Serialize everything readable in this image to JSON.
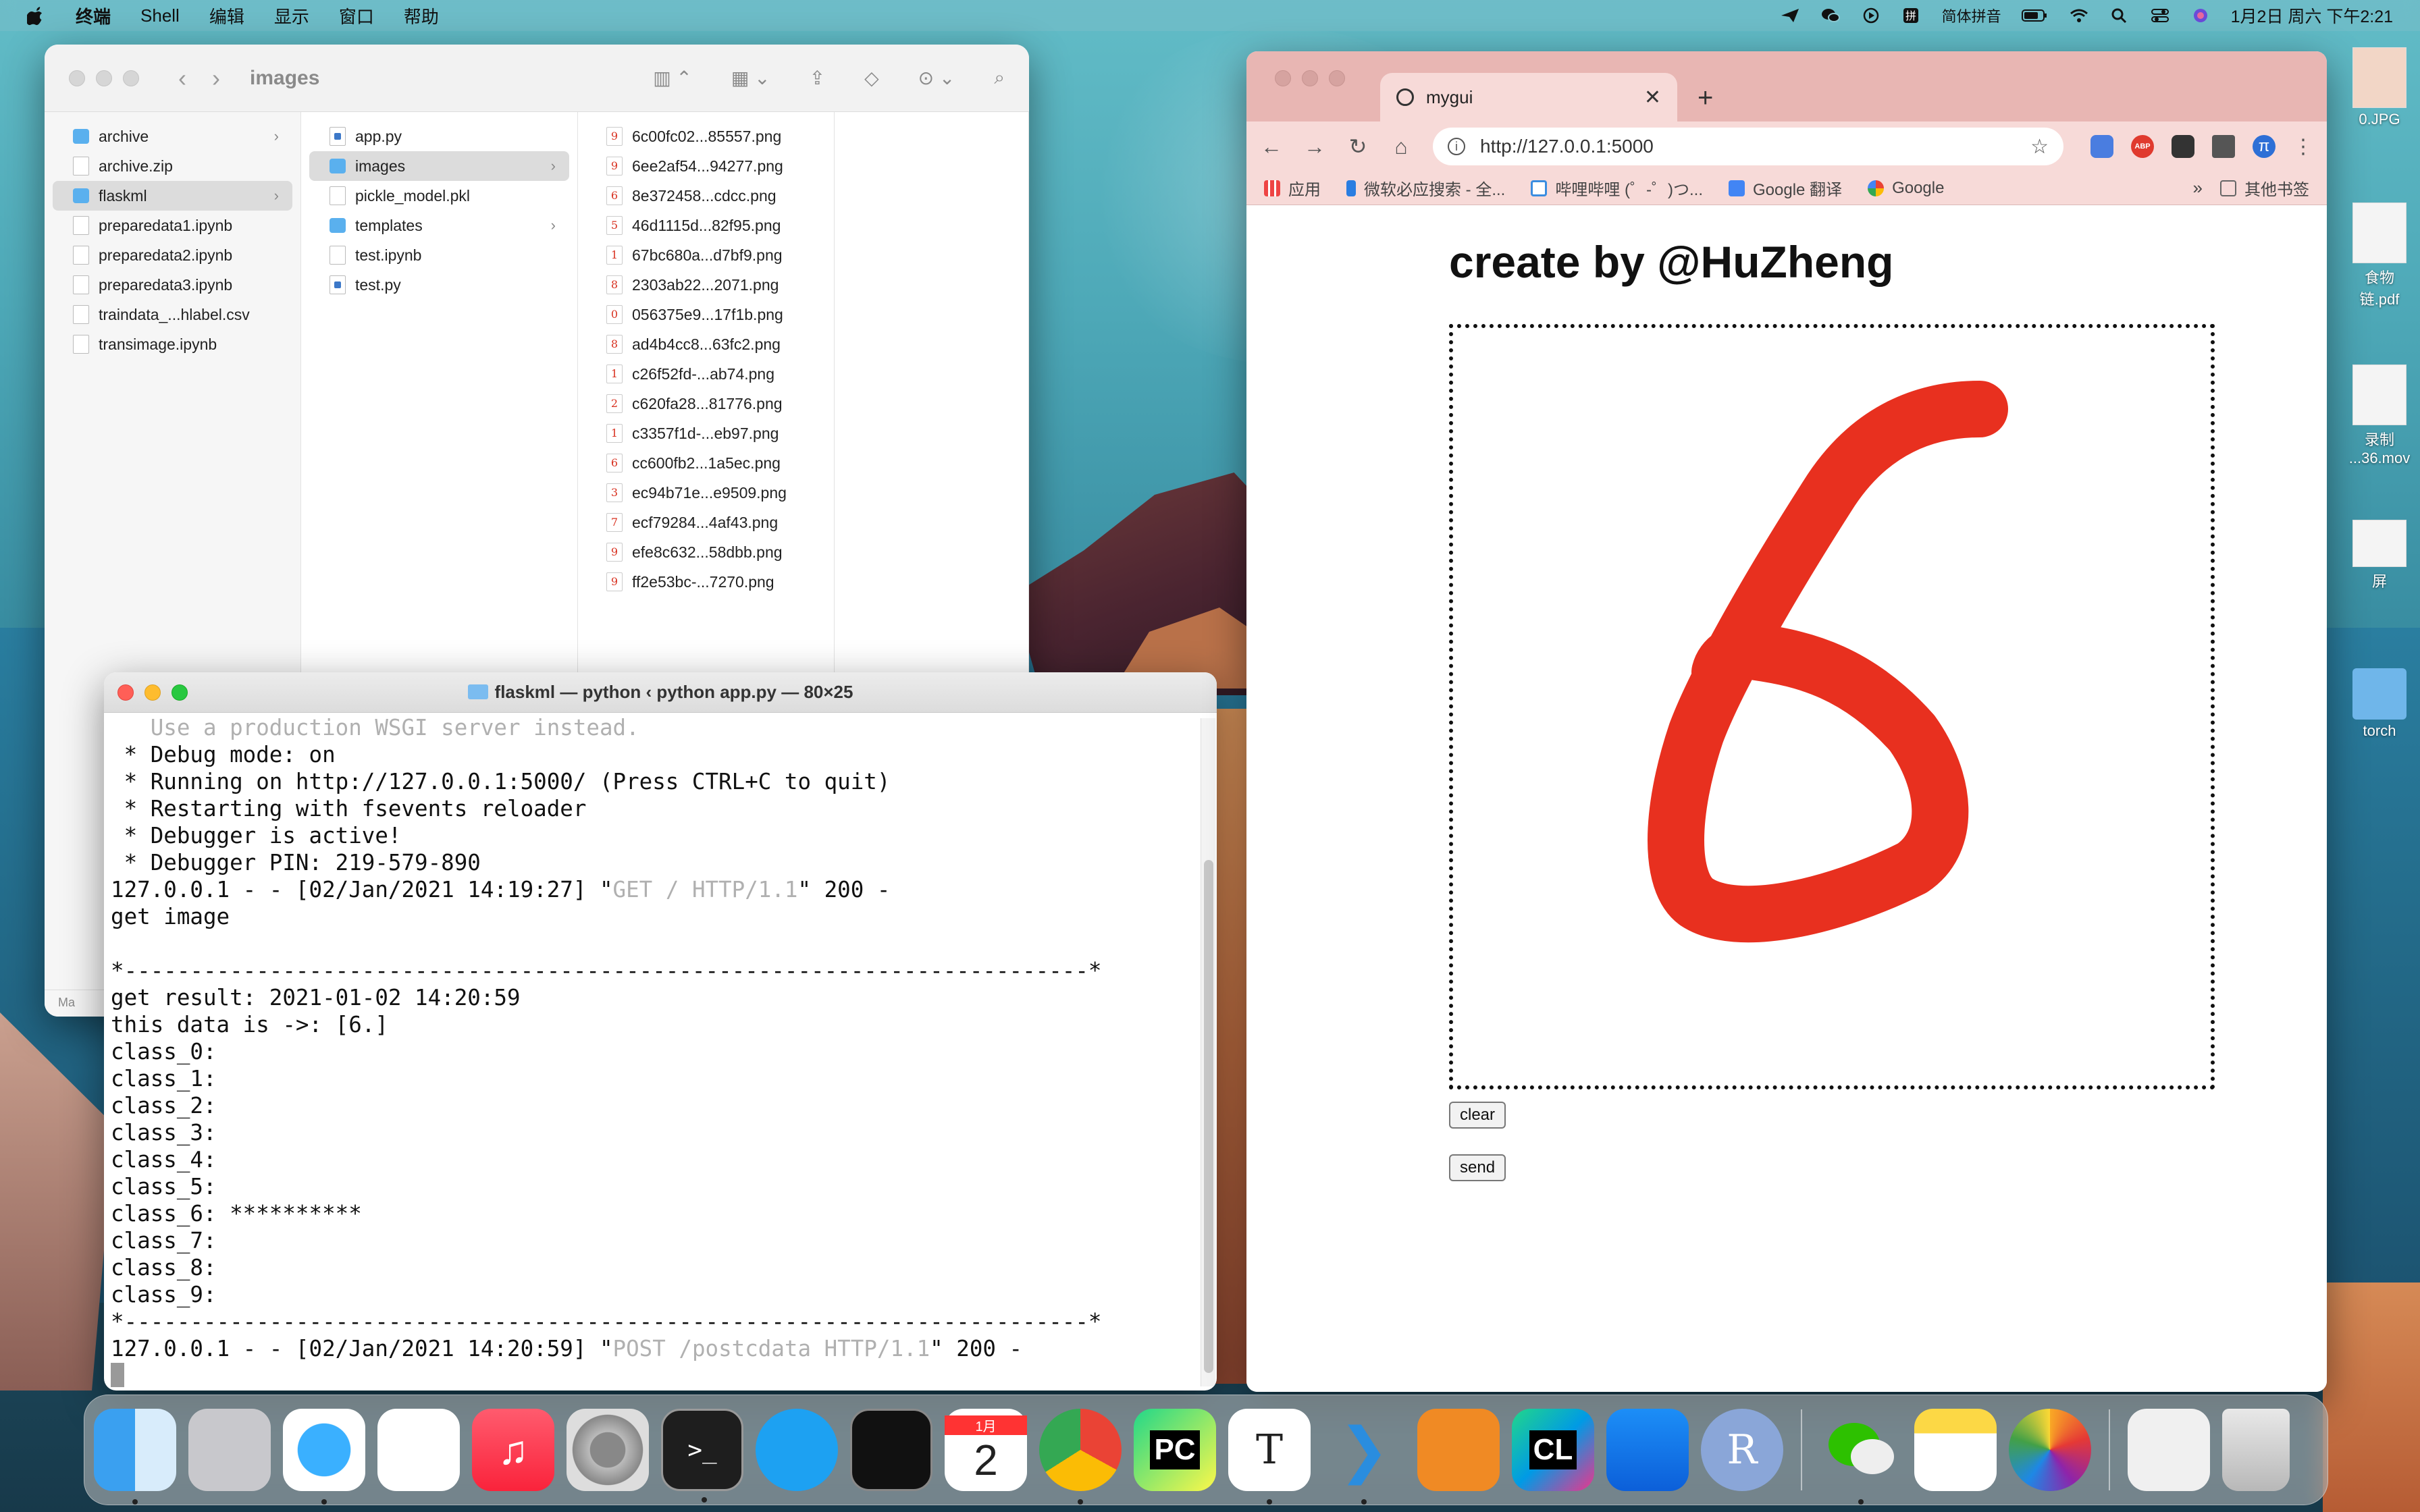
{
  "menubar": {
    "app_name": "终端",
    "items": [
      "Shell",
      "编辑",
      "显示",
      "窗口",
      "帮助"
    ],
    "input_method": "简体拼音",
    "clock": "1月2日 周六 下午2:21"
  },
  "finder": {
    "title": "images",
    "column1": [
      {
        "name": "archive",
        "type": "folder",
        "has_children": true
      },
      {
        "name": "archive.zip",
        "type": "doc"
      },
      {
        "name": "flaskml",
        "type": "folder",
        "has_children": true,
        "selected": true
      },
      {
        "name": "preparedata1.ipynb",
        "type": "doc"
      },
      {
        "name": "preparedata2.ipynb",
        "type": "doc"
      },
      {
        "name": "preparedata3.ipynb",
        "type": "doc"
      },
      {
        "name": "traindata_...hlabel.csv",
        "type": "doc"
      },
      {
        "name": "transimage.ipynb",
        "type": "doc"
      }
    ],
    "column2": [
      {
        "name": "app.py",
        "type": "py"
      },
      {
        "name": "images",
        "type": "folder",
        "has_children": true,
        "selected": true
      },
      {
        "name": "pickle_model.pkl",
        "type": "doc"
      },
      {
        "name": "templates",
        "type": "folder",
        "has_children": true
      },
      {
        "name": "test.ipynb",
        "type": "doc"
      },
      {
        "name": "test.py",
        "type": "py"
      }
    ],
    "column3": [
      {
        "name": "6c00fc02...85557.png",
        "digit": "9"
      },
      {
        "name": "6ee2af54...94277.png",
        "digit": "9"
      },
      {
        "name": "8e372458...cdcc.png",
        "digit": "6"
      },
      {
        "name": "46d1115d...82f95.png",
        "digit": "5"
      },
      {
        "name": "67bc680a...d7bf9.png",
        "digit": "1"
      },
      {
        "name": "2303ab22...2071.png",
        "digit": "8"
      },
      {
        "name": "056375e9...17f1b.png",
        "digit": "0"
      },
      {
        "name": "ad4b4cc8...63fc2.png",
        "digit": "8"
      },
      {
        "name": "c26f52fd-...ab74.png",
        "digit": "1"
      },
      {
        "name": "c620fa28...81776.png",
        "digit": "2"
      },
      {
        "name": "c3357f1d-...eb97.png",
        "digit": "1"
      },
      {
        "name": "cc600fb2...1a5ec.png",
        "digit": "6"
      },
      {
        "name": "ec94b71e...e9509.png",
        "digit": "3"
      },
      {
        "name": "ecf79284...4af43.png",
        "digit": "7"
      },
      {
        "name": "efe8c632...58dbb.png",
        "digit": "9"
      },
      {
        "name": "ff2e53bc-...7270.png",
        "digit": "9"
      }
    ],
    "statusbar": "Ma"
  },
  "terminal": {
    "title": "flaskml — python ‹ python app.py — 80×25",
    "lines": [
      {
        "text": "   Use a production WSGI server instead.",
        "grey": true
      },
      {
        "text": " * Debug mode: on"
      },
      {
        "text": " * Running on http://127.0.0.1:5000/ (Press CTRL+C to quit)"
      },
      {
        "text": " * Restarting with fsevents reloader"
      },
      {
        "text": " * Debugger is active!"
      },
      {
        "text": " * Debugger PIN: 219-579-890"
      },
      {
        "text": "127.0.0.1 - - [02/Jan/2021 14:19:27] \"",
        "tail_grey": "GET / HTTP/1.1",
        "tail": "\" 200 -"
      },
      {
        "text": "get image"
      },
      {
        "text": ""
      },
      {
        "text": "*-------------------------------------------------------------------------*"
      },
      {
        "text": "get result: 2021-01-02 14:20:59"
      },
      {
        "text": "this data is ->: [6.]"
      },
      {
        "text": "class_0:"
      },
      {
        "text": "class_1:"
      },
      {
        "text": "class_2:"
      },
      {
        "text": "class_3:"
      },
      {
        "text": "class_4:"
      },
      {
        "text": "class_5:"
      },
      {
        "text": "class_6: **********"
      },
      {
        "text": "class_7:"
      },
      {
        "text": "class_8:"
      },
      {
        "text": "class_9:"
      },
      {
        "text": "*-------------------------------------------------------------------------*"
      },
      {
        "text": "127.0.0.1 - - [02/Jan/2021 14:20:59] \"",
        "tail_grey": "POST /postcdata HTTP/1.1",
        "tail": "\" 200 -"
      }
    ]
  },
  "chrome": {
    "tab_title": "mygui",
    "url": "http://127.0.0.1:5000",
    "bookmarks": [
      "应用",
      "微软必应搜索 - 全...",
      "哔哩哔哩 (゜-゜)つ...",
      "Google 翻译",
      "Google"
    ],
    "other_bookmarks": "其他书签",
    "more_bookmarks": "»",
    "ext_abp": "ABP",
    "ext_pi": "π",
    "page": {
      "heading": "create by @HuZheng",
      "clear_label": "clear",
      "send_label": "send",
      "drawn_digit_color": "#e8301f"
    }
  },
  "desktop": {
    "icons": [
      "0.JPG",
      "食物链.pdf",
      "录制 ...36.mov",
      "屏",
      "torch"
    ]
  },
  "dock": {
    "apps": [
      "Finder",
      "Launchpad",
      "Safari",
      "Reminders",
      "Music",
      "System Preferences",
      "Terminal",
      "Twitter",
      "Activity Monitor",
      "Calendar",
      "Chrome",
      "PyCharm",
      "Typora",
      "VS Code",
      "Books",
      "CLion",
      "Xcode",
      "R",
      "WeChat",
      "Notes",
      "Photos",
      "Downloads",
      "Trash"
    ],
    "calendar_month": "1月",
    "calendar_day": "2"
  }
}
